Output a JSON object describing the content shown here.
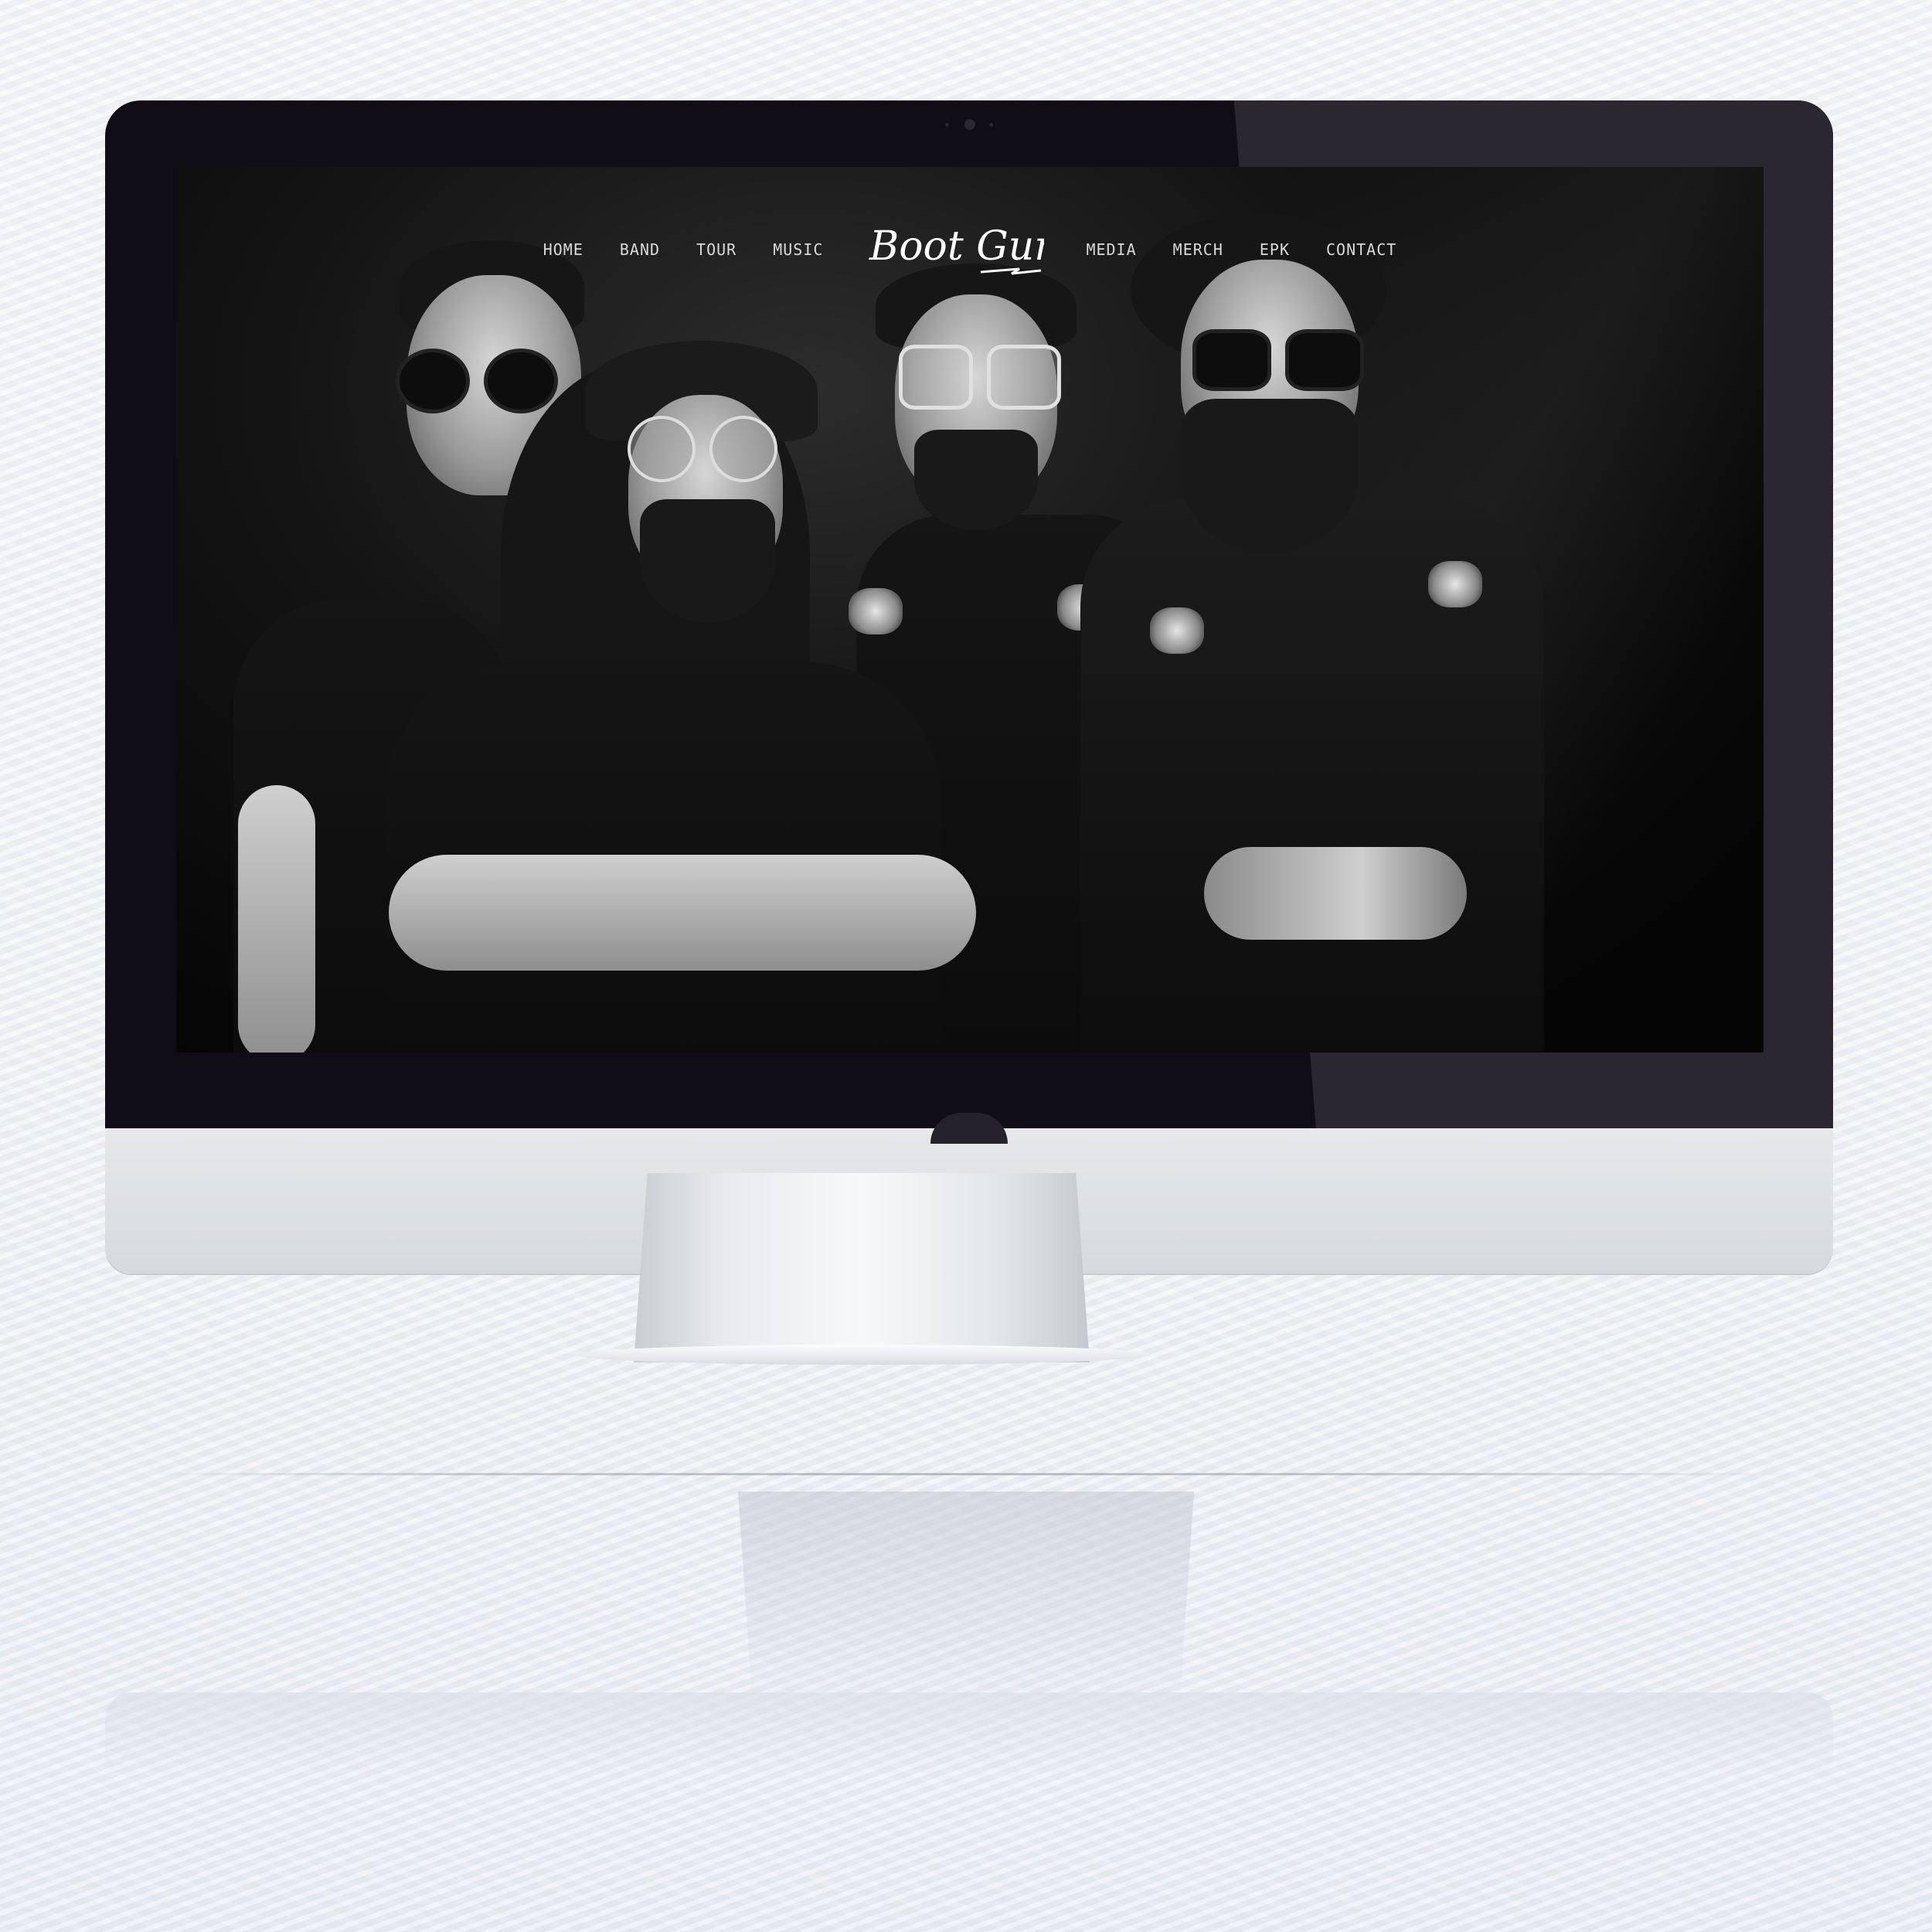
{
  "site": {
    "logo_text": "Boot Gun",
    "nav_left": [
      {
        "label": "HOME"
      },
      {
        "label": "BAND"
      },
      {
        "label": "TOUR"
      },
      {
        "label": "MUSIC"
      }
    ],
    "nav_right": [
      {
        "label": "MEDIA"
      },
      {
        "label": "MERCH"
      },
      {
        "label": "EPK"
      },
      {
        "label": "CONTACT"
      }
    ]
  },
  "hero": {
    "image": "band-photo-black-and-white"
  },
  "colors": {
    "nav_text": "#d9d9d9",
    "bezel": "#100d17",
    "screen_bg": "#080808"
  }
}
